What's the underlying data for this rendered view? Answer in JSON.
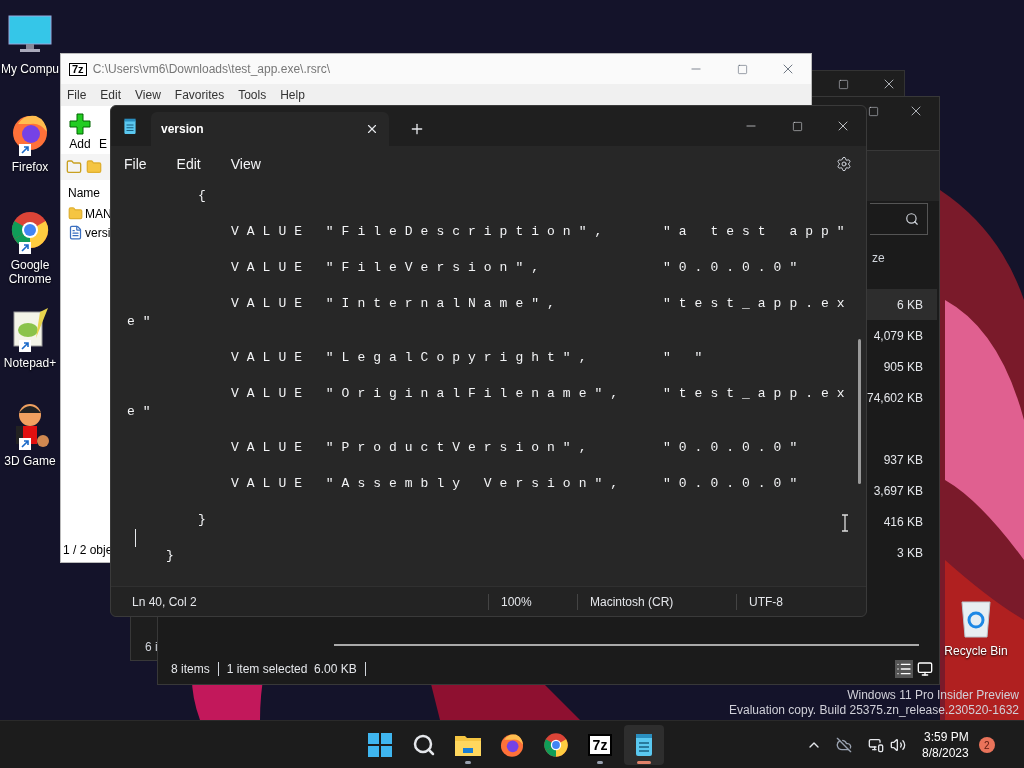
{
  "desktop": {
    "icons": [
      {
        "label": "My Compu",
        "kind": "computer"
      },
      {
        "label": "Firefox",
        "kind": "firefox"
      },
      {
        "label": "Google Chrome",
        "kind": "chrome"
      },
      {
        "label": "Notepad+",
        "kind": "notepadpp"
      },
      {
        "label": "3D Game",
        "kind": "game"
      }
    ],
    "recycle_bin": {
      "label": "Recycle Bin"
    },
    "edition_lines": [
      "Windows 11 Pro Insider Preview",
      "Evaluation copy. Build 25375.zn_release.230520-1632"
    ]
  },
  "explorer_back": {
    "status": "6 i"
  },
  "explorer": {
    "column_header": "ze",
    "rows": [
      {
        "size": "6 KB",
        "selected": true
      },
      {
        "size": "4,079 KB",
        "selected": false
      },
      {
        "size": "905 KB",
        "selected": false
      },
      {
        "size": "74,602 KB",
        "selected": false
      },
      {
        "selected": false
      },
      {
        "size": "937 KB",
        "selected": false
      },
      {
        "size": "3,697 KB",
        "selected": false
      },
      {
        "size": "416 KB",
        "selected": false
      },
      {
        "size": "3 KB",
        "selected": false
      }
    ],
    "status": [
      "8 items",
      "1 item selected  6.00 KB"
    ]
  },
  "sevenzip": {
    "logo": "7z",
    "title": "C:\\Users\\vm6\\Downloads\\test_app.exe\\.rsrc\\",
    "menu": [
      "File",
      "Edit",
      "View",
      "Favorites",
      "Tools",
      "Help"
    ],
    "toolbar": [
      "Add",
      "E"
    ],
    "column": "Name",
    "files": [
      {
        "name": "MAN",
        "kind": "folder"
      },
      {
        "name": "versi",
        "kind": "file"
      }
    ],
    "status": "1 / 2 obje"
  },
  "notepad": {
    "tabs": [
      {
        "title": "version",
        "selected": true
      }
    ],
    "menu": [
      "File",
      "Edit",
      "View"
    ],
    "lines": [
      {
        "kind": "open",
        "text": "{"
      },
      {
        "kind": "entry",
        "key": "VALUE \"FileDescription\",",
        "value": "\"a test app\""
      },
      {
        "kind": "entry",
        "key": "VALUE \"FileVersion\",",
        "value": "\"0.0.0.0\""
      },
      {
        "kind": "entry",
        "key": "VALUE \"InternalName\",",
        "value": "\"test_app.ex"
      },
      {
        "kind": "wrap",
        "text": "e\""
      },
      {
        "kind": "entry",
        "key": "VALUE \"LegalCopyright\",",
        "value": "\" \""
      },
      {
        "kind": "entry",
        "key": "VALUE \"OriginalFilename\",",
        "value": "\"test_app.ex"
      },
      {
        "kind": "wrap",
        "text": "e\""
      },
      {
        "kind": "entry",
        "key": "VALUE \"ProductVersion\",",
        "value": "\"0.0.0.0\""
      },
      {
        "kind": "entry",
        "key": "VALUE \"Assembly Version\",",
        "value": "\"0.0.0.0\""
      },
      {
        "kind": "close",
        "text": "}"
      },
      {
        "kind": "caret"
      },
      {
        "kind": "close_outer",
        "text": "}"
      }
    ],
    "status": [
      "Ln 40, Col 2",
      "100%",
      "Macintosh (CR)",
      "UTF-8"
    ]
  },
  "taskbar": {
    "apps": [
      {
        "kind": "start",
        "running": false,
        "active": false
      },
      {
        "kind": "search",
        "running": false,
        "active": false
      },
      {
        "kind": "explorer",
        "running": true,
        "active": false
      },
      {
        "kind": "firefox",
        "running": false,
        "active": false
      },
      {
        "kind": "chrome",
        "running": false,
        "active": false
      },
      {
        "kind": "sevenzip",
        "label": "7z",
        "running": true,
        "active": false
      },
      {
        "kind": "notepad",
        "running": true,
        "active": true
      }
    ],
    "time": "3:59 PM",
    "date": "8/8/2023",
    "notifications": "2"
  }
}
